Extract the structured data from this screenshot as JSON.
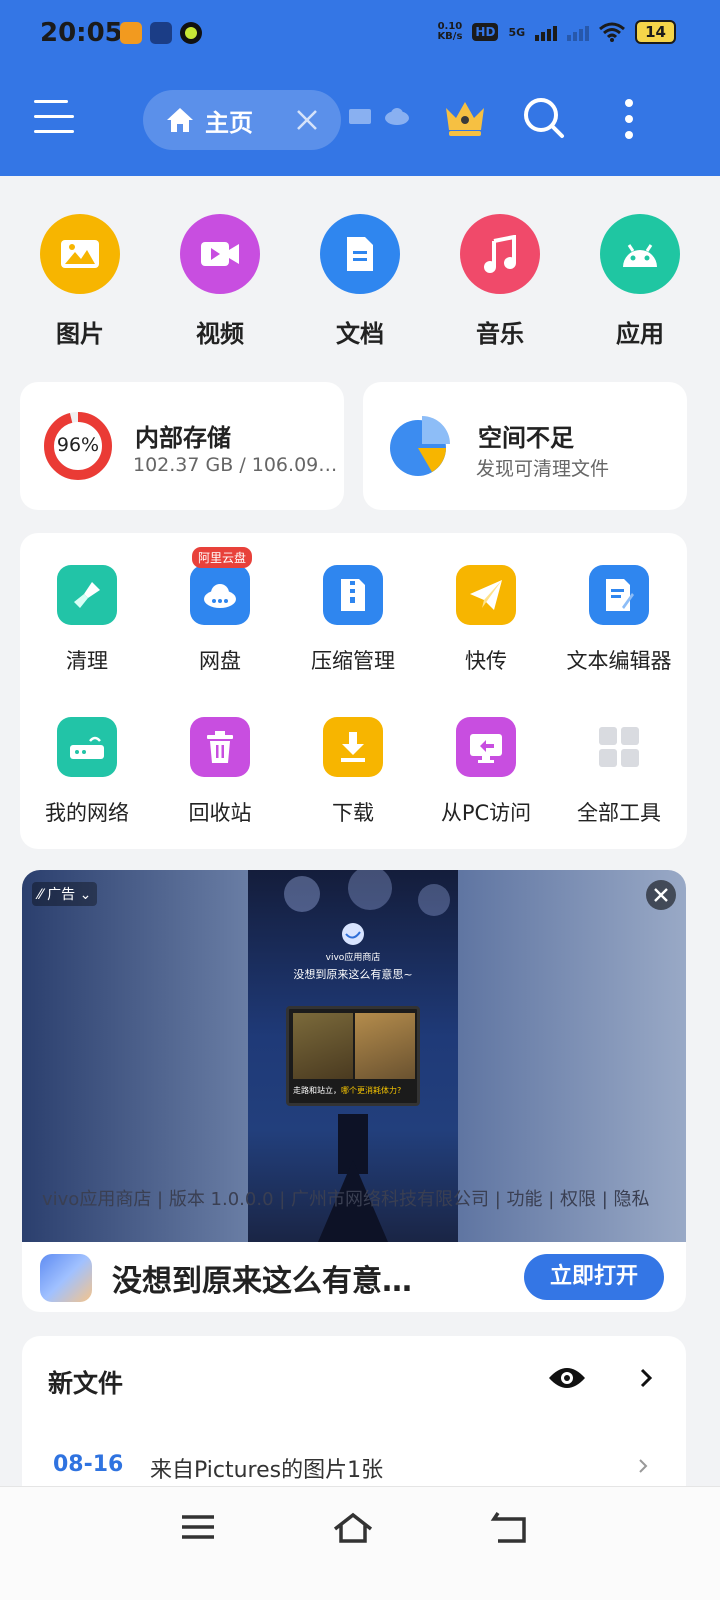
{
  "status_bar": {
    "time": "20:05",
    "speed_value": "0.10",
    "speed_unit": "KB/s",
    "hd": "HD",
    "network": "5G",
    "battery": "14"
  },
  "app_bar": {
    "tab_label": "主页"
  },
  "categories": [
    {
      "label": "图片",
      "icon": "image-icon",
      "color": "#f7b500"
    },
    {
      "label": "视频",
      "icon": "video-icon",
      "color": "#c84ee0"
    },
    {
      "label": "文档",
      "icon": "document-icon",
      "color": "#2f86ef"
    },
    {
      "label": "音乐",
      "icon": "music-icon",
      "color": "#f04a6a"
    },
    {
      "label": "应用",
      "icon": "android-icon",
      "color": "#1fc6a2"
    }
  ],
  "storage": {
    "percent": "96%",
    "used_fraction": 0.96,
    "title": "内部存储",
    "detail": "102.37 GB / 106.09…"
  },
  "space": {
    "title": "空间不足",
    "subtitle": "发现可清理文件"
  },
  "tools": [
    {
      "label": "清理",
      "icon": "broom-icon",
      "color": "#22c4a7"
    },
    {
      "label": "网盘",
      "icon": "cloud-drive-icon",
      "color": "#2f86ef",
      "badge": "阿里云盘"
    },
    {
      "label": "压缩管理",
      "icon": "zip-icon",
      "color": "#2f86ef"
    },
    {
      "label": "快传",
      "icon": "paper-plane-icon",
      "color": "#f7b500"
    },
    {
      "label": "文本编辑器",
      "icon": "text-editor-icon",
      "color": "#2f86ef"
    },
    {
      "label": "我的网络",
      "icon": "router-icon",
      "color": "#22c4a7"
    },
    {
      "label": "回收站",
      "icon": "trash-icon",
      "color": "#c84ee0"
    },
    {
      "label": "下载",
      "icon": "download-icon",
      "color": "#f7b500"
    },
    {
      "label": "从PC访问",
      "icon": "pc-access-icon",
      "color": "#c84ee0"
    },
    {
      "label": "全部工具",
      "icon": "all-tools-icon",
      "color": "#d9dbe0"
    }
  ],
  "ad": {
    "tag": "广告",
    "poster_store": "vivo应用商店",
    "poster_headline": "没想到原来这么有意思~",
    "poster_caption_a": "走路和站立，",
    "poster_caption_b": "哪个更消耗体力?",
    "info": "vivo应用商店 | 版本 1.0.0.0 | 广州市网络科技有限公司 | 功能 | 权限 | 隐私",
    "headline": "没想到原来这么有意…",
    "cta": "立即打开"
  },
  "new_files": {
    "title": "新文件",
    "rows": [
      {
        "date": "08-16",
        "desc": "来自Pictures的图片1张"
      }
    ]
  }
}
